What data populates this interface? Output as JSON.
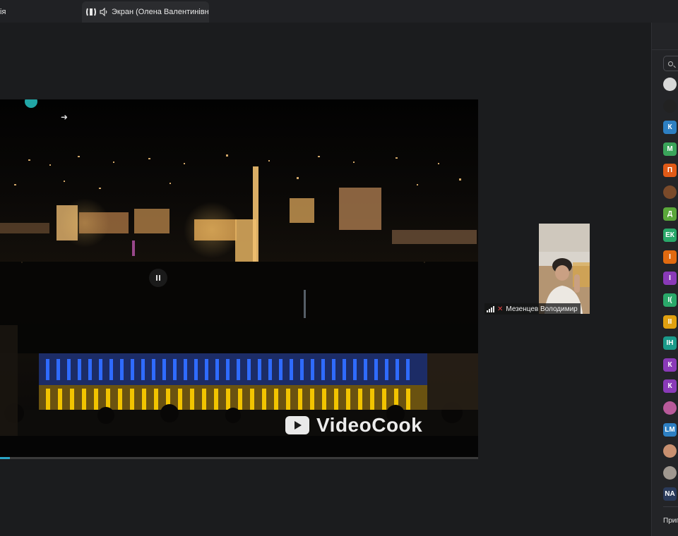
{
  "tabs": [
    {
      "label": "ія"
    },
    {
      "label": "Экран (Олена Валентинівна"
    }
  ],
  "video": {
    "watermark": "VideoCook",
    "progress_fraction": 0.02
  },
  "participant": {
    "name": "Мезенцев Володимир"
  },
  "panel": {
    "avatars": [
      {
        "letter": "",
        "color": "#d8d8d8",
        "type": "photo"
      },
      {
        "letter": "",
        "color": "#222222",
        "type": "photo"
      },
      {
        "letter": "К",
        "color": "#2d7fc2"
      },
      {
        "letter": "М",
        "color": "#3aa45a"
      },
      {
        "letter": "П",
        "color": "#e05a17"
      },
      {
        "letter": "",
        "color": "#7a4a2a",
        "type": "photo"
      },
      {
        "letter": "Д",
        "color": "#5aa83a"
      },
      {
        "letter": "ЕК",
        "color": "#2aa86a"
      },
      {
        "letter": "І",
        "color": "#e06a10"
      },
      {
        "letter": "І",
        "color": "#8a3ab8"
      },
      {
        "letter": "І(",
        "color": "#2aa86a"
      },
      {
        "letter": "ІІ",
        "color": "#e0a010"
      },
      {
        "letter": "ІН",
        "color": "#1a9a8a"
      },
      {
        "letter": "К",
        "color": "#8a3ab8"
      },
      {
        "letter": "К",
        "color": "#8a3ab8"
      },
      {
        "letter": "",
        "color": "#b85a9a",
        "type": "photo"
      },
      {
        "letter": "LM",
        "color": "#2d7fc2"
      },
      {
        "letter": "",
        "color": "#c89070",
        "type": "photo"
      },
      {
        "letter": "",
        "color": "#a09890",
        "type": "photo"
      },
      {
        "letter": "NA",
        "color": "#2a3a5a"
      }
    ],
    "invite_label": "Приг"
  },
  "colors": {
    "accent": "#2aa5c6",
    "blue_light": "#2f6bff",
    "yellow_light": "#f2c400"
  }
}
